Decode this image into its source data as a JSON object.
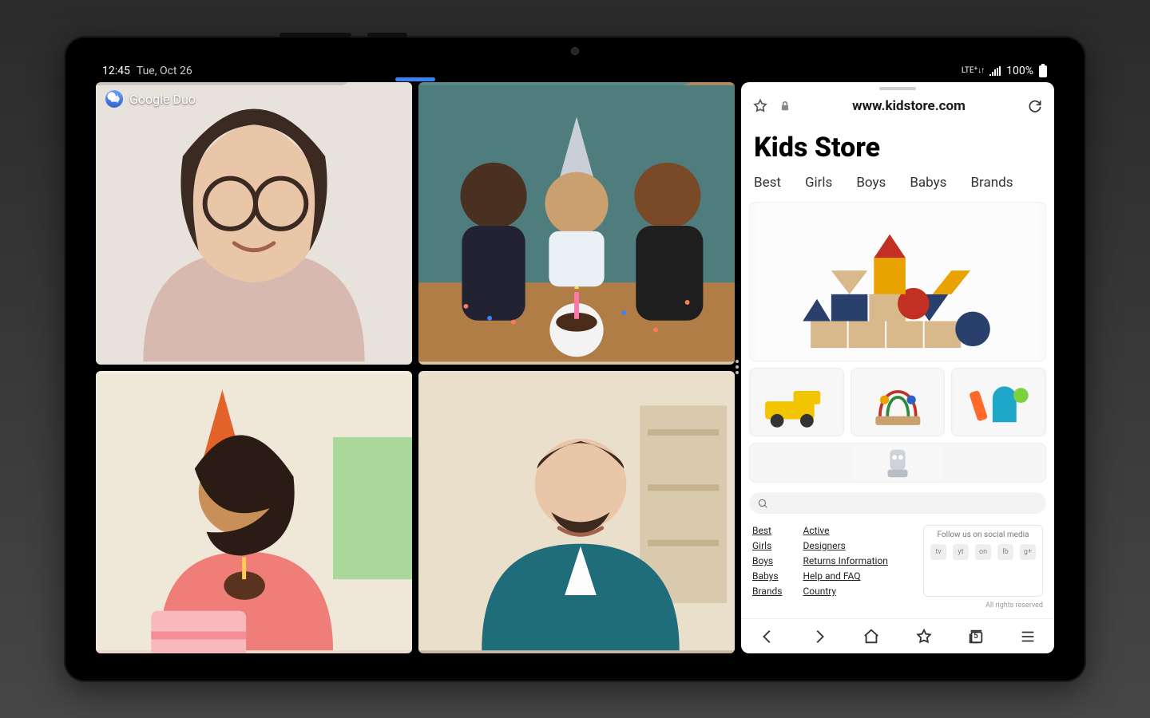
{
  "statusbar": {
    "time": "12:45",
    "date": "Tue, Oct 26",
    "network_label": "LTE",
    "battery_text": "100%"
  },
  "videocall": {
    "app_name": "Google Duo"
  },
  "browser": {
    "url": "www.kidstore.com",
    "site_title": "Kids Store",
    "tabs": [
      "Best",
      "Girls",
      "Boys",
      "Babys",
      "Brands"
    ],
    "search_placeholder": "",
    "footer_col1": [
      "Best",
      "Girls",
      "Boys",
      "Babys",
      "Brands"
    ],
    "footer_col2": [
      "Active",
      "Designers",
      "Returns Information",
      "Help and FAQ",
      "Country"
    ],
    "social_heading": "Follow us on social media",
    "social_labels": [
      "tv",
      "yt",
      "on",
      "lb",
      "g+"
    ],
    "rights_text": "All rights reserved",
    "nav_tab_count": "5"
  }
}
